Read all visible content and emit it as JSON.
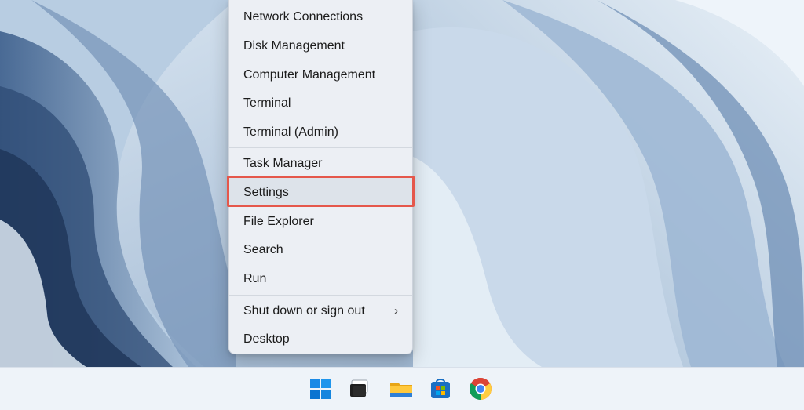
{
  "context_menu": {
    "items": [
      {
        "label": "Network Connections"
      },
      {
        "label": "Disk Management"
      },
      {
        "label": "Computer Management"
      },
      {
        "label": "Terminal"
      },
      {
        "label": "Terminal (Admin)"
      },
      {
        "label": "Task Manager"
      },
      {
        "label": "Settings",
        "highlighted": true
      },
      {
        "label": "File Explorer"
      },
      {
        "label": "Search"
      },
      {
        "label": "Run"
      },
      {
        "label": "Shut down or sign out",
        "has_submenu": true
      },
      {
        "label": "Desktop"
      }
    ],
    "submenu_glyph": "›",
    "highlight_color": "#e5574b"
  },
  "taskbar": {
    "icons": [
      {
        "name": "windows-start-icon"
      },
      {
        "name": "task-view-icon"
      },
      {
        "name": "file-explorer-icon"
      },
      {
        "name": "microsoft-store-icon"
      },
      {
        "name": "chrome-icon"
      }
    ]
  },
  "colors": {
    "accent": "#0078d4",
    "highlight_border": "#e5574b"
  }
}
